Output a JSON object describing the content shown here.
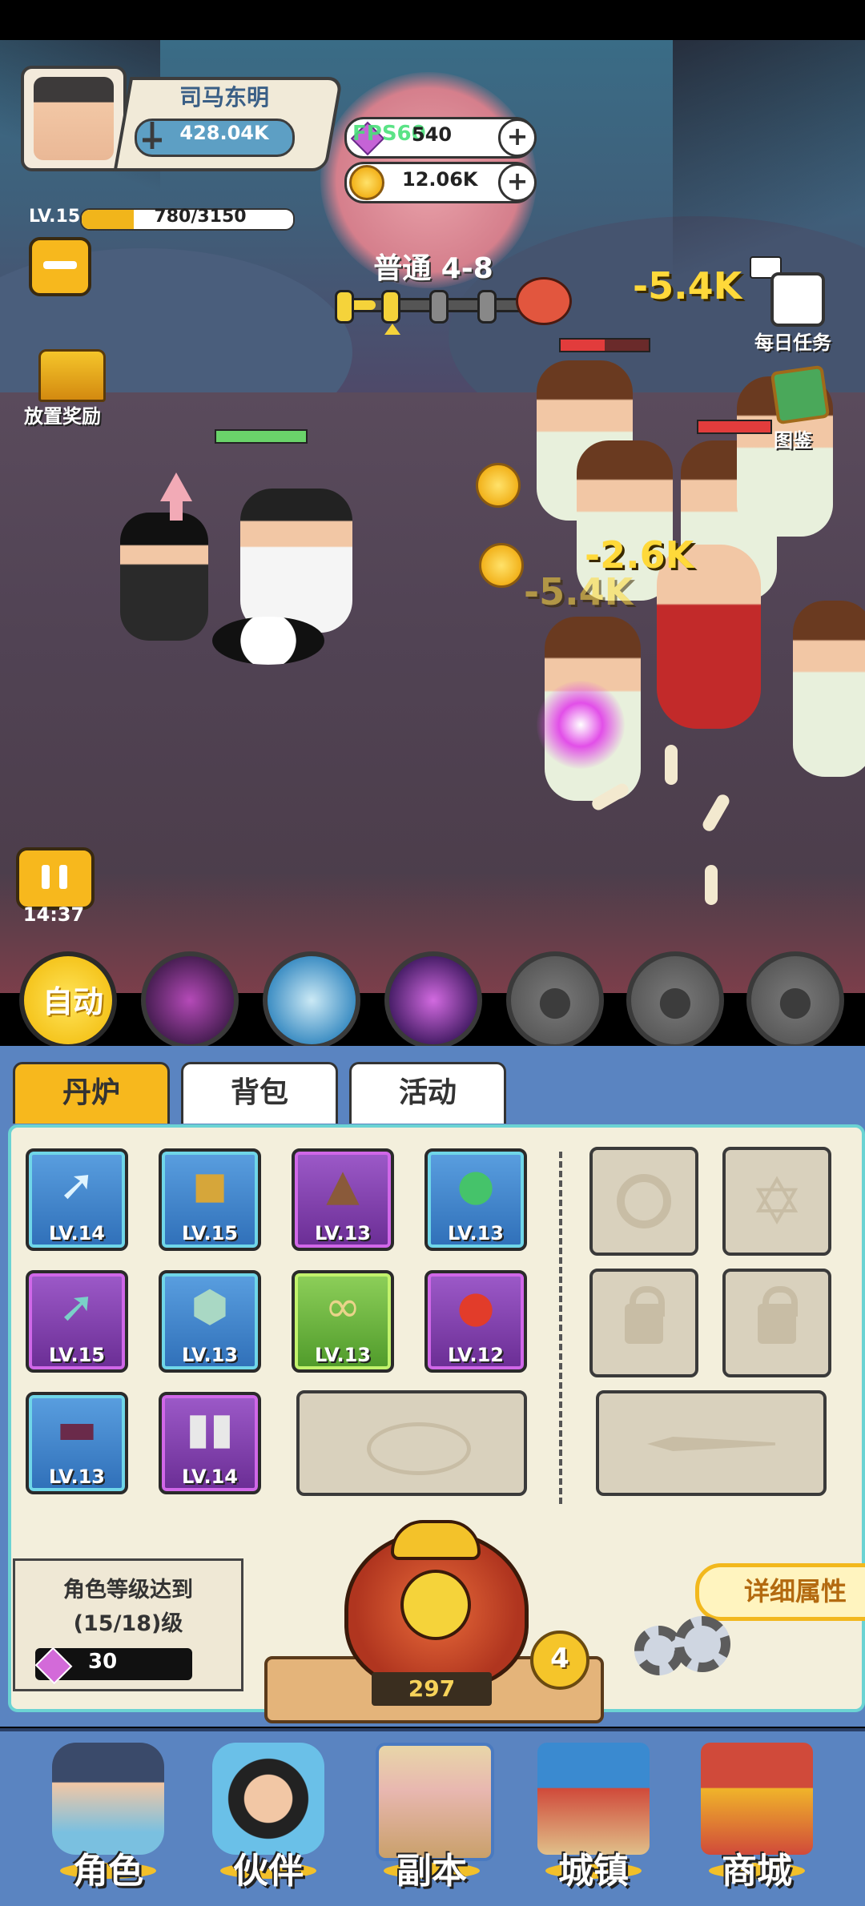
{
  "player": {
    "name": "司马东明",
    "power": "428.04K",
    "level_label": "LV.15",
    "xp_text": "780/3150",
    "xp_fraction": 0.2476
  },
  "resources": {
    "fps_label": "FPS60",
    "gems": "540",
    "gold": "12.06K",
    "plus": "+"
  },
  "stage": {
    "label": "普通 4-8",
    "progress": 0.2
  },
  "side_buttons": {
    "idle_reward": "放置奖励",
    "daily_tasks": "每日任务",
    "codex": "图鉴"
  },
  "damage_numbers": {
    "top": "-5.4K",
    "middle": "-2.6K",
    "lower": "-5.4K"
  },
  "battle": {
    "timer": "14:37"
  },
  "skills": {
    "auto_label": "自动"
  },
  "tabs": [
    {
      "label": "丹炉",
      "active": true
    },
    {
      "label": "背包",
      "active": false
    },
    {
      "label": "活动",
      "active": false
    }
  ],
  "equipment": [
    {
      "level": "LV.14",
      "rarity": "blue",
      "icon": "spear-icon"
    },
    {
      "level": "LV.15",
      "rarity": "blue",
      "icon": "armor-icon"
    },
    {
      "level": "LV.13",
      "rarity": "purple",
      "icon": "axe-pack-icon"
    },
    {
      "level": "LV.13",
      "rarity": "blue",
      "icon": "jade-orb-icon"
    },
    {
      "level": "LV.15",
      "rarity": "purple",
      "icon": "sword-icon"
    },
    {
      "level": "LV.13",
      "rarity": "blue",
      "icon": "jade-pendant-icon"
    },
    {
      "level": "LV.13",
      "rarity": "green",
      "icon": "gourd-icon"
    },
    {
      "level": "LV.12",
      "rarity": "purple",
      "icon": "red-orb-icon"
    },
    {
      "level": "LV.13",
      "rarity": "blue",
      "icon": "belt-icon"
    },
    {
      "level": "LV.14",
      "rarity": "purple",
      "icon": "boots-icon"
    }
  ],
  "unlock_requirement": {
    "line1": "角色等级达到",
    "line2": "(15/18)级",
    "gem_cost": "30"
  },
  "cauldron": {
    "count": "297",
    "badge": "4"
  },
  "detail_button": "详细属性",
  "nav": [
    {
      "label": "角色",
      "icon": "character-icon"
    },
    {
      "label": "伙伴",
      "icon": "partner-icon"
    },
    {
      "label": "副本",
      "icon": "dungeon-scroll-icon"
    },
    {
      "label": "城镇",
      "icon": "town-icon"
    },
    {
      "label": "商城",
      "icon": "shop-icon"
    }
  ],
  "colors": {
    "accent_yellow": "#f7b81d",
    "panel_blue": "#5a84c1",
    "inner_cream": "#f3efdc",
    "damage_yellow": "#ffd93a"
  }
}
